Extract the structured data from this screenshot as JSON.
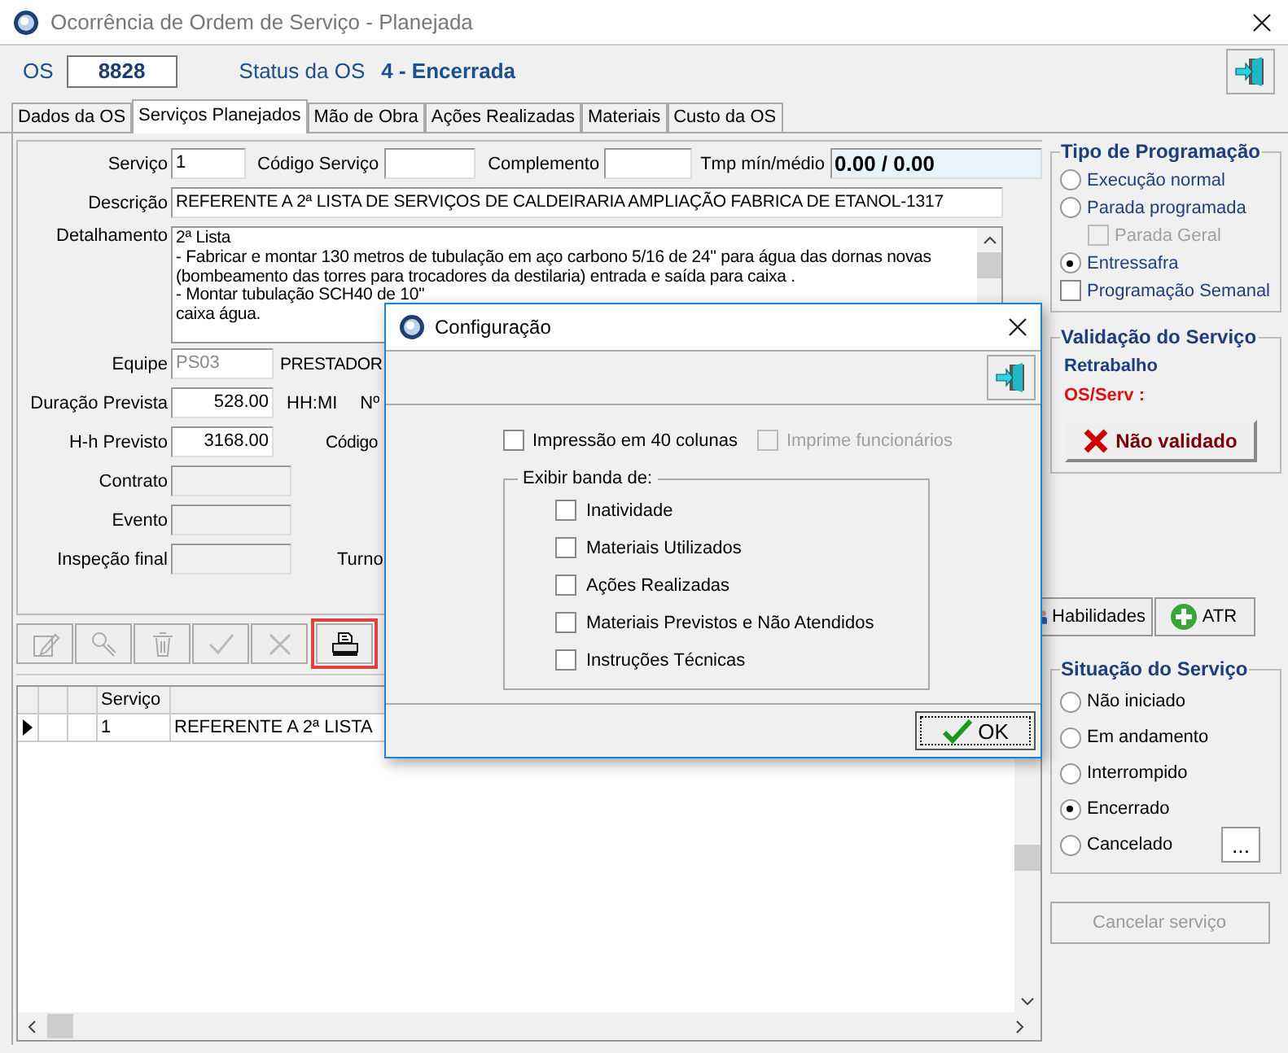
{
  "window": {
    "title": "Ocorrência de Ordem de Serviço - Planejada"
  },
  "header": {
    "os_label": "OS",
    "os_number": "8828",
    "status_label": "Status da OS",
    "status_value": "4 - Encerrada"
  },
  "tabs": [
    {
      "label": "Dados da OS",
      "selected": false
    },
    {
      "label": "Serviços Planejados",
      "selected": true
    },
    {
      "label": "Mão de Obra",
      "selected": false
    },
    {
      "label": "Ações Realizadas",
      "selected": false
    },
    {
      "label": "Materiais",
      "selected": false
    },
    {
      "label": "Custo da OS",
      "selected": false
    }
  ],
  "form": {
    "servico": {
      "label": "Serviço",
      "value": "1"
    },
    "codigo_servico": {
      "label": "Código Serviço"
    },
    "complemento": {
      "label": "Complemento"
    },
    "tmp": {
      "label": "Tmp mín/médio",
      "value": "0.00 / 0.00"
    },
    "descricao": {
      "label": "Descrição",
      "value": "REFERENTE A 2ª LISTA DE SERVIÇOS DE CALDEIRARIA AMPLIAÇÃO FABRICA DE ETANOL-1317"
    },
    "detalhamento": {
      "label": "Detalhamento",
      "lines": [
        "2ª Lista",
        "- Fabricar e montar 130 metros de tubulação em aço carbono 5/16 de 24'' para água das dornas novas",
        "(bombeamento das torres para trocadores da destilaria) entrada e saída para caixa .",
        "- Montar tubulação SCH40 de 10''",
        "caixa água."
      ]
    },
    "equipe": {
      "label": "Equipe",
      "value": "PS03",
      "name": "PRESTADOR",
      "disabled": true
    },
    "duracao": {
      "label": "Duração Prevista",
      "value": "528.00",
      "unit": "HH:MI",
      "side_label": "Nº"
    },
    "hh": {
      "label": "H-h Previsto",
      "value": "3168.00",
      "side_label": "Código"
    },
    "contrato": {
      "label": "Contrato"
    },
    "evento": {
      "label": "Evento"
    },
    "inspecao": {
      "label": "Inspeção final",
      "side_label": "Turno"
    }
  },
  "toolbar": [
    {
      "disabled": true,
      "highlighted": false
    },
    {
      "disabled": true,
      "highlighted": false
    },
    {
      "disabled": true,
      "highlighted": false
    },
    {
      "disabled": true,
      "highlighted": false
    },
    {
      "disabled": true,
      "highlighted": false
    },
    {
      "disabled": false,
      "highlighted": true
    }
  ],
  "grid": {
    "columns": [
      {
        "label": "Serviço"
      }
    ],
    "rows": [
      {
        "current": true,
        "cells": [
          "1",
          "REFERENTE A 2ª LISTA"
        ]
      }
    ]
  },
  "tipo_programacao": {
    "title": "Tipo de Programação",
    "options": [
      {
        "label": "Execução normal",
        "selected": false
      },
      {
        "label": "Parada programada",
        "selected": false,
        "children": [
          {
            "label": "Parada Geral",
            "checked": false,
            "disabled": true
          }
        ]
      },
      {
        "label": "Entressafra",
        "selected": true
      }
    ],
    "semanal": {
      "label": "Programação Semanal",
      "checked": false
    }
  },
  "validacao": {
    "title": "Validação do Serviço",
    "retrabalho": "Retrabalho",
    "os_serv": "OS/Serv :",
    "button": "Não validado"
  },
  "actions": [
    {
      "label": "Habilidades"
    },
    {
      "label": "ATR"
    }
  ],
  "situacao": {
    "title": "Situação do Serviço",
    "options": [
      {
        "label": "Não iniciado",
        "selected": false
      },
      {
        "label": "Em andamento",
        "selected": false
      },
      {
        "label": "Interrompido",
        "selected": false
      },
      {
        "label": "Encerrado",
        "selected": true
      },
      {
        "label": "Cancelado",
        "selected": false
      }
    ],
    "more_button": "..."
  },
  "cancel_button": {
    "label": "Cancelar serviço",
    "disabled": true
  },
  "dialog": {
    "title": "Configuração",
    "options": [
      {
        "label": "Impressão em 40 colunas",
        "checked": false,
        "disabled": false
      },
      {
        "label": "Imprime funcionários",
        "checked": false,
        "disabled": true
      }
    ],
    "group": {
      "title": "Exibir banda de:",
      "items": [
        {
          "label": "Inatividade",
          "checked": false
        },
        {
          "label": "Materiais Utilizados",
          "checked": false
        },
        {
          "label": "Ações Realizadas",
          "checked": false
        },
        {
          "label": "Materiais Previstos e Não Atendidos",
          "checked": false
        },
        {
          "label": "Instruções Técnicas",
          "checked": false
        }
      ]
    },
    "ok": "OK"
  }
}
